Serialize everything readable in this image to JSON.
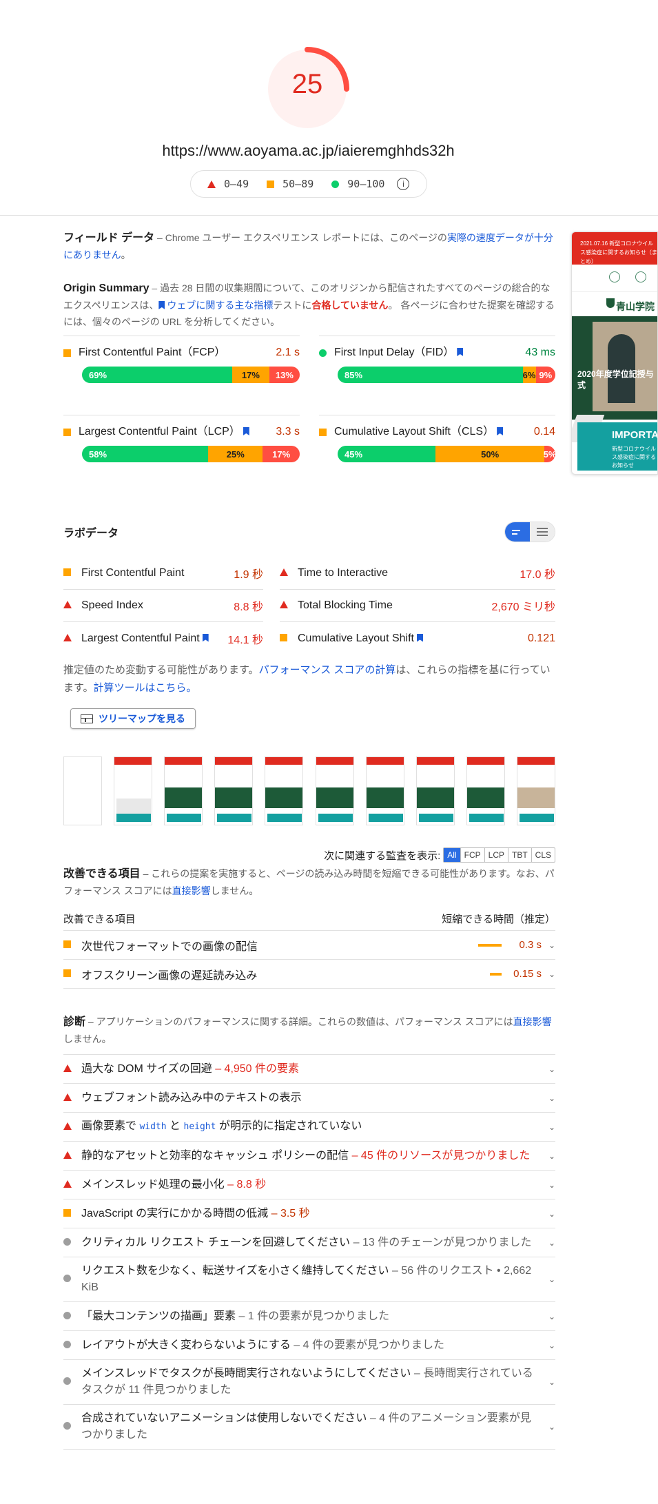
{
  "header": {
    "score": 25,
    "score_text": "25",
    "url": "https://www.aoyama.ac.jp/iaieremghhds32h",
    "legend": [
      {
        "range": "0–49",
        "color": "#ff4e42"
      },
      {
        "range": "50–89",
        "color": "#ffa400"
      },
      {
        "range": "90–100",
        "color": "#0cce6b"
      }
    ],
    "info_icon": "i"
  },
  "field": {
    "title": "フィールド データ",
    "desc_prefix": " – Chrome ユーザー エクスペリエンス レポートには、このページの",
    "desc_link": "実際の速度データが十分にありません",
    "desc_suffix": "。"
  },
  "origin": {
    "title": "Origin Summary",
    "desc_1": " – 過去 28 日間の収集期間について、このオリジンから配信されたすべてのページの総合的なエクスペリエンスは、",
    "desc_link": "ウェブに関する主な指標",
    "desc_2": "テストに",
    "desc_fail": "合格していません",
    "desc_3": "。 各ページに合わせた提案を確認するには、個々のページの URL を分析してください。",
    "metrics": [
      {
        "label": "First Contentful Paint（FCP）",
        "value": "2.1 s",
        "status": "average",
        "flag": false,
        "bar": [
          {
            "pct": 69,
            "label": "69%"
          },
          {
            "pct": 17,
            "label": "17%"
          },
          {
            "pct": 13,
            "label": "13%"
          }
        ]
      },
      {
        "label": "First Input Delay（FID）",
        "value": "43 ms",
        "status": "pass",
        "flag": true,
        "bar": [
          {
            "pct": 85,
            "label": "85%"
          },
          {
            "pct": 6,
            "label": "6%"
          },
          {
            "pct": 9,
            "label": "9%"
          }
        ]
      },
      {
        "label": "Largest Contentful Paint（LCP）",
        "value": "3.3 s",
        "status": "average",
        "flag": true,
        "bar": [
          {
            "pct": 58,
            "label": "58%"
          },
          {
            "pct": 25,
            "label": "25%"
          },
          {
            "pct": 17,
            "label": "17%"
          }
        ]
      },
      {
        "label": "Cumulative Layout Shift（CLS）",
        "value": "0.14",
        "status": "average",
        "flag": true,
        "bar": [
          {
            "pct": 45,
            "label": "45%"
          },
          {
            "pct": 50,
            "label": "50%"
          },
          {
            "pct": 5,
            "label": "5%"
          }
        ]
      }
    ]
  },
  "lab": {
    "title": "ラボデータ",
    "left": [
      {
        "label": "First Contentful Paint",
        "value": "1.9 秒",
        "status": "average",
        "flag": false
      },
      {
        "label": "Speed Index",
        "value": "8.8 秒",
        "status": "fail",
        "flag": false
      },
      {
        "label": "Largest Contentful Paint",
        "value": "14.1 秒",
        "status": "fail",
        "flag": true
      }
    ],
    "right": [
      {
        "label": "Time to Interactive",
        "value": "17.0 秒",
        "status": "fail",
        "flag": false
      },
      {
        "label": "Total Blocking Time",
        "value": "2,670 ミリ秒",
        "status": "fail",
        "flag": false
      },
      {
        "label": "Cumulative Layout Shift",
        "value": "0.121",
        "status": "average",
        "flag": true
      }
    ],
    "note_1": "推定値のため変動する可能性があります。",
    "note_link1": "パフォーマンス スコアの計算",
    "note_2": "は、これらの指標を基に行っています。",
    "note_link2": "計算ツールはこちら。",
    "treemap_label": "ツリーマップを見る"
  },
  "filter": {
    "label": "次に関連する監査を表示:",
    "chips": [
      "All",
      "FCP",
      "LCP",
      "TBT",
      "CLS"
    ],
    "active": "All"
  },
  "opportunities": {
    "title": "改善できる項目",
    "desc_1": " – これらの提案を実施すると、ページの読み込み時間を短縮できる可能性があります。なお、パフォーマンス スコアには",
    "desc_link": "直接影響",
    "desc_2": "しません。",
    "col_left": "改善できる項目",
    "col_right": "短縮できる時間（推定）",
    "items": [
      {
        "label": "次世代フォーマットでの画像の配信",
        "value": "0.3 s",
        "bar_fraction": 1.0
      },
      {
        "label": "オフスクリーン画像の遅延読み込み",
        "value": "0.15 s",
        "bar_fraction": 0.5
      }
    ]
  },
  "diagnostics": {
    "title": "診断",
    "desc_1": " – アプリケーションのパフォーマンスに関する詳細。これらの数値は、パフォーマンス スコアには",
    "desc_link": "直接影響",
    "desc_2": "しません。",
    "items": [
      {
        "label": "過大な DOM サイズの回避",
        "detail": " – 4,950 件の要素",
        "status": "fail"
      },
      {
        "label": "ウェブフォント読み込み中のテキストの表示",
        "detail": "",
        "status": "fail"
      },
      {
        "label_1": "画像要素で ",
        "code_1": "width",
        "label_2": " と ",
        "code_2": "height",
        "label_3": " が明示的に指定されていない",
        "status": "fail",
        "has_code": true
      },
      {
        "label": "静的なアセットと効率的なキャッシュ ポリシーの配信",
        "detail": " – 45 件のリソースが見つかりました",
        "status": "fail"
      },
      {
        "label": "メインスレッド処理の最小化",
        "detail": " – 8.8 秒",
        "status": "fail"
      },
      {
        "label": "JavaScript の実行にかかる時間の低減",
        "detail": " – 3.5 秒",
        "status": "average"
      },
      {
        "label": "クリティカル リクエスト チェーンを回避してください",
        "detail": " – 13 件のチェーンが見つかりました",
        "status": "info"
      },
      {
        "label": "リクエスト数を少なく、転送サイズを小さく維持してください",
        "detail": " – 56 件のリクエスト • 2,662 KiB",
        "status": "info"
      },
      {
        "label": "「最大コンテンツの描画」要素",
        "detail": " – 1 件の要素が見つかりました",
        "status": "info"
      },
      {
        "label": "レイアウトが大きく変わらないようにする",
        "detail": " – 4 件の要素が見つかりました",
        "status": "info"
      },
      {
        "label": "メインスレッドでタスクが長時間実行されないようにしてください",
        "detail": " – 長時間実行されているタスクが 11 件見つかりました",
        "status": "info"
      },
      {
        "label": "合成されていないアニメーションは使用しないでください",
        "detail": " – 4 件のアニメーション要素が見つかりました",
        "status": "info"
      }
    ]
  },
  "preview": {
    "top_text": "2021.07.16 新型コロナウイルス感染症に関するお知らせ（まとめ）",
    "logo_text": "青山学院",
    "hero_text": "2020年度学位記授与式",
    "teal_big": "IMPORTANT",
    "teal_small": "新型コロナウイルス感染症に関するお知らせ"
  },
  "colors": {
    "fail": "#ff4e42",
    "average": "#ffa400",
    "pass": "#0cce6b",
    "link": "#1a5ad8"
  }
}
